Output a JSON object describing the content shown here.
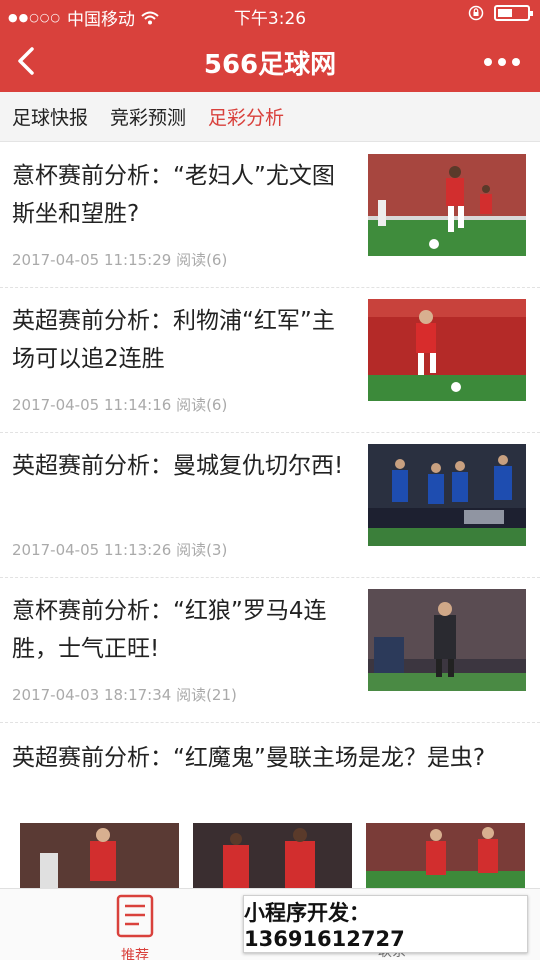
{
  "status": {
    "carrier": "中国移动",
    "time": "下午3:26"
  },
  "nav": {
    "title": "566足球网"
  },
  "tabs": [
    {
      "label": "足球快报"
    },
    {
      "label": "竞彩预测"
    },
    {
      "label": "足彩分析"
    }
  ],
  "active_tab": "足彩分析",
  "articles": [
    {
      "title": "意杯赛前分析：“老妇人”尤文图斯坐和望胜?",
      "meta": "2017-04-05 11:15:29 阅读(6)"
    },
    {
      "title": "英超赛前分析：利物浦“红军”主场可以追2连胜",
      "meta": "2017-04-05 11:14:16 阅读(6)"
    },
    {
      "title": "英超赛前分析：曼城复仇切尔西!",
      "meta": "2017-04-05 11:13:26 阅读(3)"
    },
    {
      "title": "意杯赛前分析：“红狼”罗马4连胜，士气正旺!",
      "meta": "2017-04-03 18:17:34 阅读(21)"
    }
  ],
  "last_article": {
    "title": "英超赛前分析：“红魔鬼”曼联主场是龙？是虫?"
  },
  "bottom_nav": {
    "home_label": "推荐",
    "hidden_label": "联系"
  },
  "promo": {
    "text": "小程序开发：13691612727"
  },
  "colors": {
    "brand_red": "#d9413c",
    "meta_gray": "#aaaaaa"
  }
}
